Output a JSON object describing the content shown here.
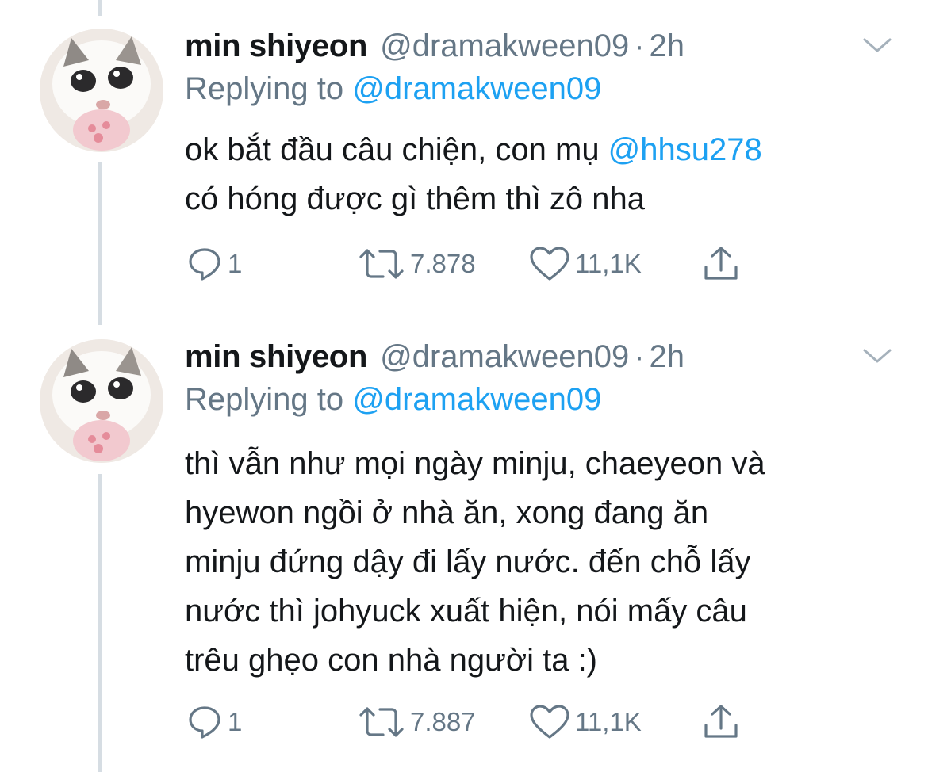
{
  "tweets": [
    {
      "display_name": "min shiyeon",
      "handle": "@dramakween09",
      "dot": "·",
      "time": "2h",
      "replying_prefix": "Replying to",
      "replying_to": "@dramakween09",
      "body_lines": [
        [
          "ok bắt đầu câu chiện, con mụ ",
          "@hhsu278"
        ],
        [
          "có hóng được gì thêm thì zô nha"
        ]
      ],
      "replies": "1",
      "retweets": "7.878",
      "likes": "11,1K"
    },
    {
      "display_name": "min shiyeon",
      "handle": "@dramakween09",
      "dot": "·",
      "time": "2h",
      "replying_prefix": "Replying to",
      "replying_to": "@dramakween09",
      "body_lines": [
        [
          "thì vẫn như mọi ngày minju, chaeyeon và"
        ],
        [
          "hyewon ngồi ở nhà ăn, xong đang ăn"
        ],
        [
          "minju đứng dậy đi lấy nước. đến chỗ lấy"
        ],
        [
          "nước thì johyuck xuất hiện, nói mấy câu"
        ],
        [
          "trêu ghẹo con nhà người ta :)"
        ]
      ],
      "replies": "1",
      "retweets": "7.887",
      "likes": "11,1K"
    }
  ],
  "icons": {
    "reply": "reply-icon",
    "retweet": "retweet-icon",
    "like": "heart-icon",
    "share": "share-icon",
    "menu": "chevron-down-icon"
  },
  "colors": {
    "text": "#14171a",
    "secondary": "#657786",
    "link": "#1da1f2",
    "thread_line": "#d6dde3"
  }
}
